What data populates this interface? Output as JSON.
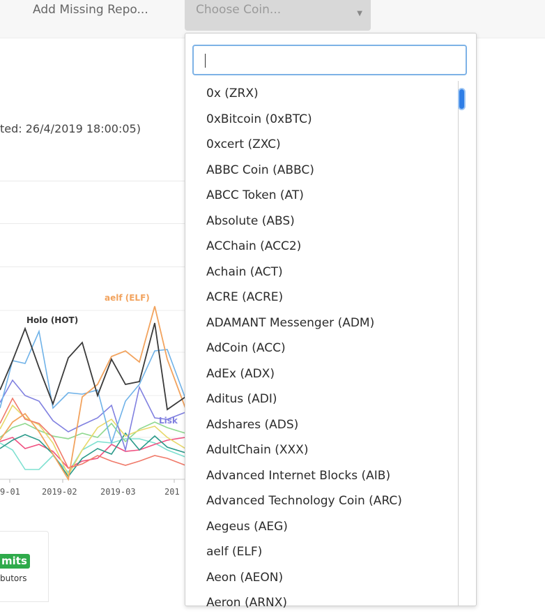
{
  "topbar": {
    "add_missing_label": "Add Missing Repo...",
    "choose_coin_placeholder": "Choose Coin..."
  },
  "updated_text": "ted: 26/4/2019 18:00:05)",
  "chart_data": {
    "type": "line",
    "x_tick_labels": [
      "9-01",
      "2019-02",
      "2019-03",
      "201"
    ],
    "series": [
      {
        "name": "Holo (HOT)",
        "color": "#3a3a3a"
      },
      {
        "name": "aelf (ELF)",
        "color": "#f2a35e"
      },
      {
        "name": "Lisk",
        "color": "#8080e0"
      },
      {
        "color": "#6fb2e8"
      },
      {
        "color": "#f07a6a"
      },
      {
        "color": "#e8d86a"
      },
      {
        "color": "#8fd88f"
      },
      {
        "color": "#2a9a8a"
      },
      {
        "color": "#f05080"
      },
      {
        "color": "#7ee0d0"
      }
    ]
  },
  "card": {
    "badge": "mits",
    "label": "butors",
    "badge_color": "#2eaa4a"
  },
  "dropdown": {
    "search_value": "",
    "options": [
      "0x (ZRX)",
      "0xBitcoin (0xBTC)",
      "0xcert (ZXC)",
      "ABBC Coin (ABBC)",
      "ABCC Token (AT)",
      "Absolute (ABS)",
      "ACChain (ACC2)",
      "Achain (ACT)",
      "ACRE (ACRE)",
      "ADAMANT Messenger (ADM)",
      "AdCoin (ACC)",
      "AdEx (ADX)",
      "Aditus (ADI)",
      "Adshares (ADS)",
      "AdultChain (XXX)",
      "Advanced Internet Blocks (AIB)",
      "Advanced Technology Coin (ARC)",
      "Aegeus (AEG)",
      "aelf (ELF)",
      "Aeon (AEON)",
      "Aeron (ARNX)"
    ]
  }
}
